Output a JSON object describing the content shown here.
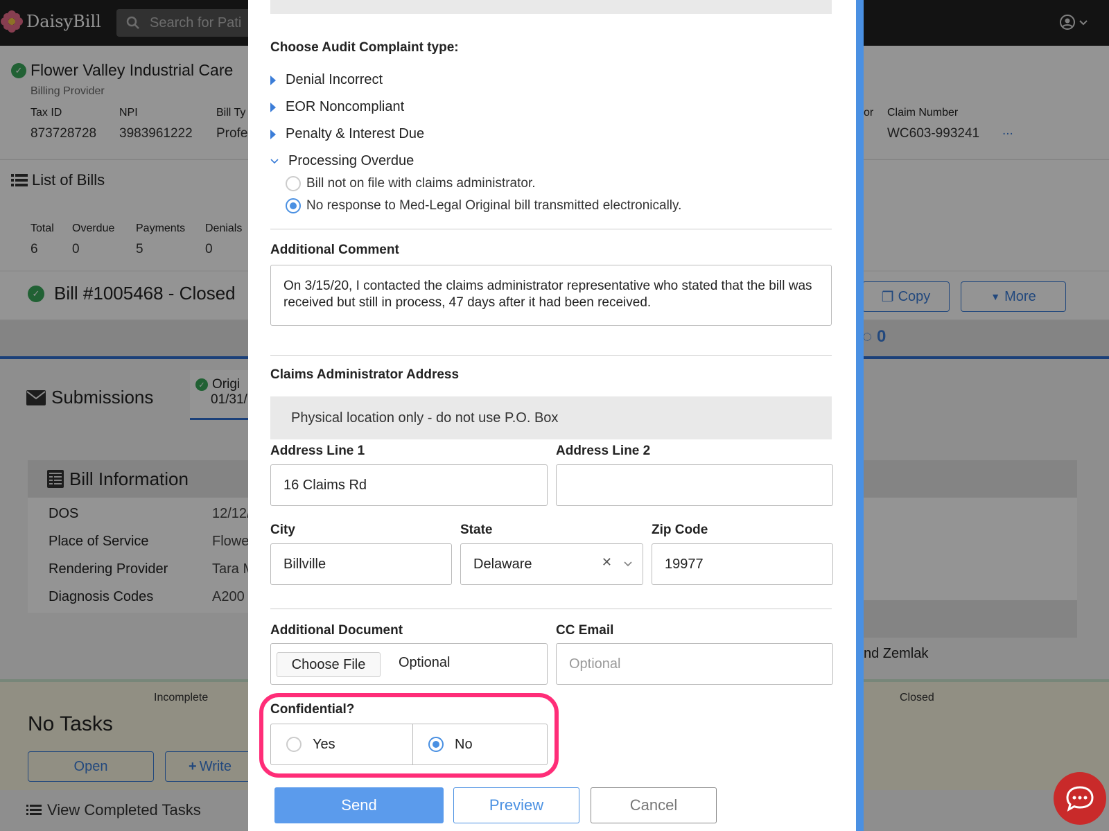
{
  "app": {
    "logo_text": "DaisyBill",
    "search_placeholder": "Search for Pati"
  },
  "provider": {
    "name": "Flower Valley Industrial Care",
    "role": "Billing Provider",
    "tax_id_label": "Tax ID",
    "tax_id": "873728728",
    "npi_label": "NPI",
    "npi": "3983961222",
    "bill_type_label": "Bill Ty",
    "bill_type": "Profe",
    "or_fragment": "or",
    "claim_label": "Claim Number",
    "claim": "WC603-993241",
    "more_dots": "..."
  },
  "bills": {
    "title": "List of Bills",
    "stats": [
      {
        "label": "Total",
        "value": "6"
      },
      {
        "label": "Overdue",
        "value": "0"
      },
      {
        "label": "Payments",
        "value": "5"
      },
      {
        "label": "Denials",
        "value": "0"
      }
    ]
  },
  "bill": {
    "title": "Bill #1005468 - Closed",
    "copy_label": "Copy",
    "more_label": "More",
    "comments_count": "0"
  },
  "submissions": {
    "title": "Submissions",
    "tab_line1": "Origi",
    "tab_line2": "01/31/"
  },
  "bill_info": {
    "title": "Bill Information",
    "rows": [
      {
        "label": "DOS",
        "value": "12/12/"
      },
      {
        "label": "Place of Service",
        "value": "Flowe"
      },
      {
        "label": "Rendering Provider",
        "value": "Tara M"
      },
      {
        "label": "Diagnosis Codes",
        "value": "A200"
      }
    ],
    "right_text": "nd Zemlak"
  },
  "tasks": {
    "incomplete_label": "Incomplete",
    "closed_label": "Closed",
    "no_tasks": "No Tasks",
    "open_label": "Open",
    "write_label": "Write",
    "view_completed": "View Completed Tasks"
  },
  "modal": {
    "complaint_type_title": "Choose Audit Complaint type:",
    "types": [
      {
        "label": "Denial Incorrect"
      },
      {
        "label": "EOR Noncompliant"
      },
      {
        "label": "Penalty & Interest Due"
      },
      {
        "label": "Processing Overdue"
      }
    ],
    "overdue_options": [
      {
        "label": "Bill not on file with claims administrator.",
        "selected": false
      },
      {
        "label": "No response to Med-Legal Original bill transmitted electronically.",
        "selected": true
      }
    ],
    "comment_label": "Additional Comment",
    "comment_value": "On 3/15/20, I contacted the claims administrator representative who stated that the bill was received but still in process, 47 days after it had been received.",
    "address_title": "Claims Administrator Address",
    "address_note": "Physical location only - do not use P.O. Box",
    "address1_label": "Address Line 1",
    "address1_value": "16 Claims Rd",
    "address2_label": "Address Line 2",
    "address2_value": "",
    "city_label": "City",
    "city_value": "Billville",
    "state_label": "State",
    "state_value": "Delaware",
    "zip_label": "Zip Code",
    "zip_value": "19977",
    "doc_label": "Additional Document",
    "choose_file": "Choose File",
    "doc_optional": "Optional",
    "cc_label": "CC Email",
    "cc_placeholder": "Optional",
    "confidential_label": "Confidential?",
    "yes_label": "Yes",
    "no_label": "No",
    "confidential_selected": "No",
    "send_label": "Send",
    "preview_label": "Preview",
    "cancel_label": "Cancel"
  },
  "colors": {
    "accent": "#4a90e2",
    "highlight": "#ff2d78",
    "success": "#3aa85b"
  }
}
